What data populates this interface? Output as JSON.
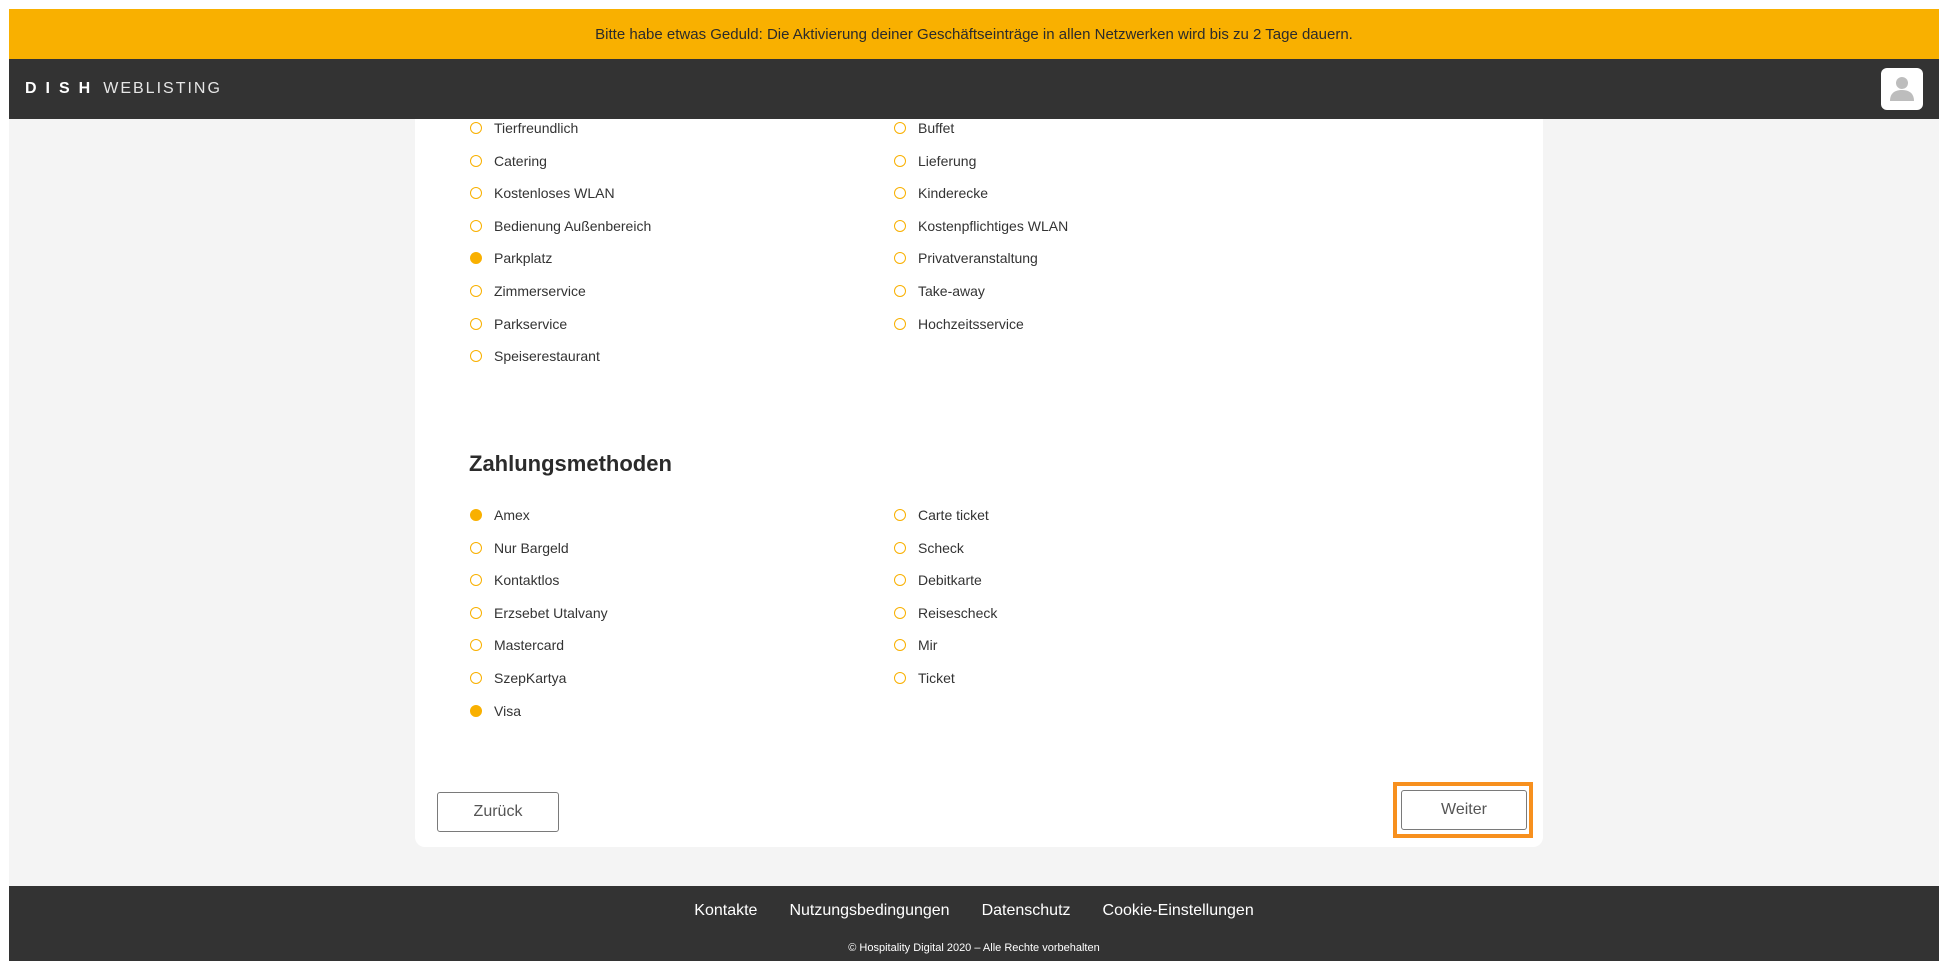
{
  "banner": {
    "text": "Bitte habe etwas Geduld: Die Aktivierung deiner Geschäftseinträge in allen Netzwerken wird bis zu 2 Tage dauern."
  },
  "header": {
    "logo_bold": "DISH",
    "logo_light": "WEBLISTING"
  },
  "amenities": {
    "left": [
      {
        "label": "Tierfreundlich",
        "checked": false
      },
      {
        "label": "Catering",
        "checked": false
      },
      {
        "label": "Kostenloses WLAN",
        "checked": false
      },
      {
        "label": "Bedienung Außenbereich",
        "checked": false
      },
      {
        "label": "Parkplatz",
        "checked": true
      },
      {
        "label": "Zimmerservice",
        "checked": false
      },
      {
        "label": "Parkservice",
        "checked": false
      },
      {
        "label": "Speiserestaurant",
        "checked": false
      }
    ],
    "right": [
      {
        "label": "Buffet",
        "checked": false
      },
      {
        "label": "Lieferung",
        "checked": false
      },
      {
        "label": "Kinderecke",
        "checked": false
      },
      {
        "label": "Kostenpflichtiges WLAN",
        "checked": false
      },
      {
        "label": "Privatveranstaltung",
        "checked": false
      },
      {
        "label": "Take-away",
        "checked": false
      },
      {
        "label": "Hochzeitsservice",
        "checked": false
      }
    ]
  },
  "payment": {
    "title": "Zahlungsmethoden",
    "left": [
      {
        "label": "Amex",
        "checked": true
      },
      {
        "label": "Nur Bargeld",
        "checked": false
      },
      {
        "label": "Kontaktlos",
        "checked": false
      },
      {
        "label": "Erzsebet Utalvany",
        "checked": false
      },
      {
        "label": "Mastercard",
        "checked": false
      },
      {
        "label": "SzepKartya",
        "checked": false
      },
      {
        "label": "Visa",
        "checked": true
      }
    ],
    "right": [
      {
        "label": "Carte ticket",
        "checked": false
      },
      {
        "label": "Scheck",
        "checked": false
      },
      {
        "label": "Debitkarte",
        "checked": false
      },
      {
        "label": "Reisescheck",
        "checked": false
      },
      {
        "label": "Mir",
        "checked": false
      },
      {
        "label": "Ticket",
        "checked": false
      }
    ]
  },
  "buttons": {
    "back": "Zurück",
    "next": "Weiter"
  },
  "footer": {
    "links": [
      "Kontakte",
      "Nutzungsbedingungen",
      "Datenschutz",
      "Cookie-Einstellungen"
    ],
    "copyright": "© Hospitality Digital 2020 – Alle Rechte vorbehalten"
  },
  "colors": {
    "accent": "#f9b000",
    "highlight": "#f7901e",
    "dark": "#333333"
  }
}
